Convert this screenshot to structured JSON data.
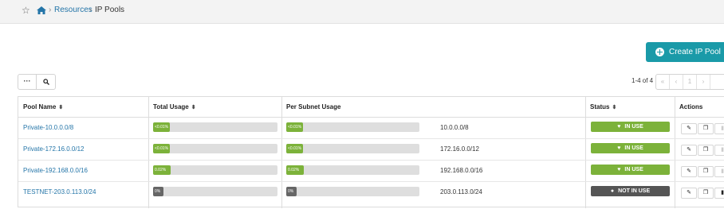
{
  "breadcrumb": {
    "star_icon": "☆",
    "sep": "›",
    "resources": "Resources",
    "current": "IP Pools"
  },
  "toolbar": {
    "create_label": "Create IP Pool",
    "more_label": "···",
    "search_icon": "⌕"
  },
  "pager": {
    "range": "1-4 of 4",
    "first": "«",
    "prev": "‹",
    "page": "1",
    "next": "›"
  },
  "table": {
    "columns": {
      "pool_name": "Pool Name",
      "total_usage": "Total Usage",
      "per_subnet": "Per Subnet Usage",
      "status": "Status",
      "actions": "Actions"
    },
    "sort_icon": "⬍",
    "rows": [
      {
        "name": "Private-10.0.0.0/8",
        "total": "<0.01%",
        "subnet_usage": "<0.01%",
        "subnet": "10.0.0.0/8",
        "status": "IN USE",
        "status_icon": "♥"
      },
      {
        "name": "Private-172.16.0.0/12",
        "total": "<0.01%",
        "subnet_usage": "<0.01%",
        "subnet": "172.16.0.0/12",
        "status": "IN USE",
        "status_icon": "♥"
      },
      {
        "name": "Private-192.168.0.0/16",
        "total": "0.02%",
        "subnet_usage": "0.02%",
        "subnet": "192.168.0.0/16",
        "status": "IN USE",
        "status_icon": "♥"
      },
      {
        "name": "TESTNET-203.0.113.0/24",
        "total": "0%",
        "subnet_usage": "0%",
        "subnet": "203.0.113.0/24",
        "status": "NOT IN USE",
        "status_icon": "●"
      }
    ],
    "action_icons": {
      "edit": "✎",
      "copy": "❐",
      "delete": "▮"
    }
  },
  "colors": {
    "accent": "#1a9aa8",
    "link": "#2475a8",
    "in_use": "#7cb23a",
    "not_in_use": "#555555"
  }
}
